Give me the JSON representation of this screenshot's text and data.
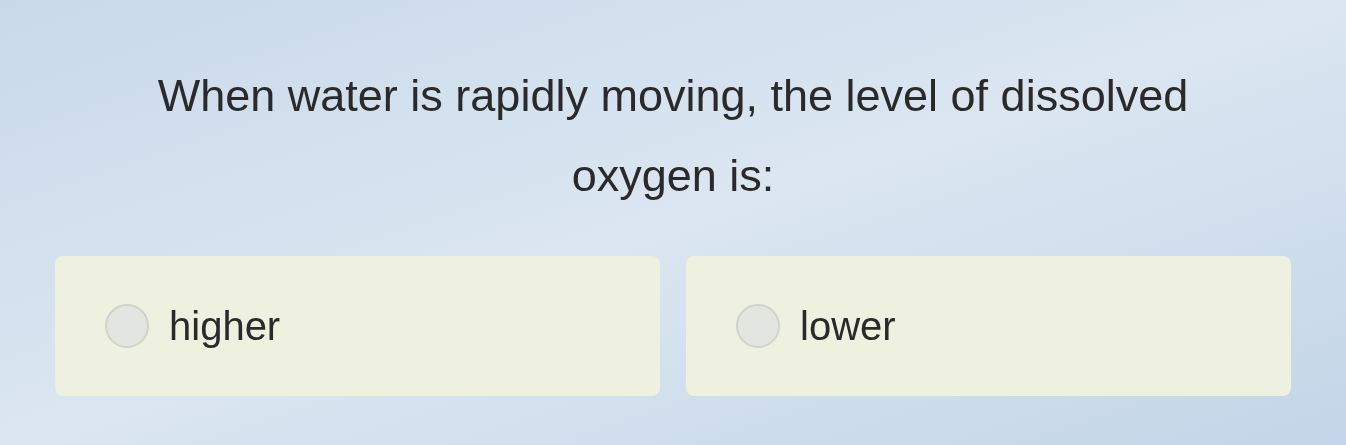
{
  "question": "When water is rapidly moving, the level of dissolved oxygen is:",
  "options": [
    {
      "label": "higher",
      "selected": false
    },
    {
      "label": "lower",
      "selected": false
    }
  ]
}
